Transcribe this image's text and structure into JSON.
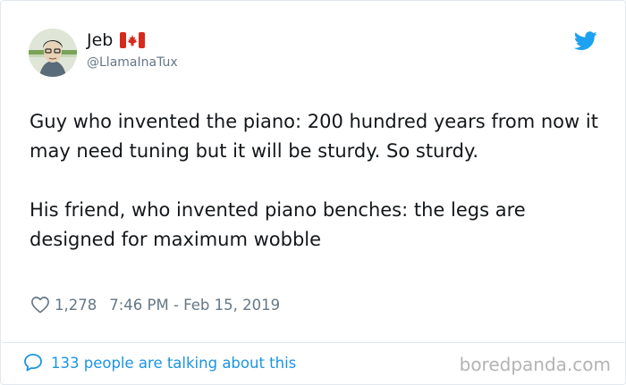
{
  "tweet": {
    "display_name": "Jeb",
    "flag_icon": "canada-flag-icon",
    "handle": "@LlamaInaTux",
    "paragraphs": [
      "Guy who invented the piano: 200 hundred years from now it may need tuning but it will be sturdy. So sturdy.",
      "His friend, who invented piano benches: the legs are designed for maximum wobble"
    ],
    "likes": "1,278",
    "timestamp": "7:46 PM - Feb 15, 2019",
    "talking": "133 people are talking about this"
  },
  "watermark": "boredpanda.com",
  "colors": {
    "twitter_blue": "#1da1f2",
    "link_blue": "#1b95e0",
    "muted_text": "#657786",
    "text": "#14171a",
    "border": "#e1e8ed"
  }
}
